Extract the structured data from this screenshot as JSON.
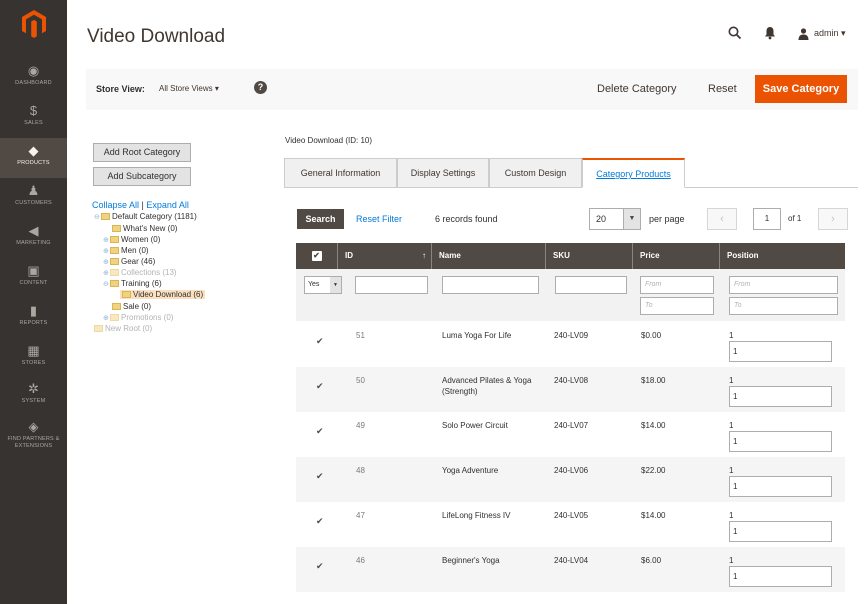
{
  "nav": {
    "items": [
      {
        "label": "Dashboard",
        "icon": "speedometer-icon",
        "glyph": "◉"
      },
      {
        "label": "Sales",
        "icon": "dollar-icon",
        "glyph": "$"
      },
      {
        "label": "Products",
        "icon": "cube-icon",
        "glyph": "◆"
      },
      {
        "label": "Customers",
        "icon": "person-icon",
        "glyph": "♟"
      },
      {
        "label": "Marketing",
        "icon": "megaphone-icon",
        "glyph": "◀"
      },
      {
        "label": "Content",
        "icon": "layout-icon",
        "glyph": "▣"
      },
      {
        "label": "Reports",
        "icon": "bar-chart-icon",
        "glyph": "▮"
      },
      {
        "label": "Stores",
        "icon": "store-icon",
        "glyph": "▦"
      },
      {
        "label": "System",
        "icon": "gear-icon",
        "glyph": "✲"
      },
      {
        "label": "Find Partners & Extensions",
        "icon": "cube-stack-icon",
        "glyph": "◈"
      }
    ]
  },
  "header": {
    "title": "Video Download",
    "user": "admin ▾"
  },
  "actions": {
    "store_view_label": "Store View:",
    "store_view_value": "All Store Views ▾",
    "help_glyph": "?",
    "delete": "Delete Category",
    "reset": "Reset",
    "save": "Save Category"
  },
  "tree": {
    "add_root": "Add Root Category",
    "add_sub": "Add Subcategory",
    "collapse_all": "Collapse All",
    "separator": " | ",
    "expand_all": "Expand All",
    "nodes": [
      {
        "label": "Default Category (1181)"
      },
      {
        "label": "What's New (0)"
      },
      {
        "label": "Women (0)"
      },
      {
        "label": "Men (0)"
      },
      {
        "label": "Gear (46)"
      },
      {
        "label": "Collections (13)"
      },
      {
        "label": "Training (6)"
      },
      {
        "label": "Video Download (6)"
      },
      {
        "label": "Sale (0)"
      },
      {
        "label": "Promotions (0)"
      },
      {
        "label": "New Root (0)"
      }
    ]
  },
  "main": {
    "breadcrumb": "Video Download (ID: 10)",
    "tabs": [
      "General Information",
      "Display Settings",
      "Custom Design",
      "Category Products"
    ],
    "search": "Search",
    "reset_filter": "Reset Filter",
    "records": "6 records found",
    "per_page_value": "20",
    "per_page_label": "per page",
    "page_current": "1",
    "page_of": "of 1",
    "prev": "‹",
    "next": "›"
  },
  "grid": {
    "columns": [
      "",
      "ID",
      "Name",
      "SKU",
      "Price",
      "Position"
    ],
    "filter": {
      "in_category": "Yes",
      "from": "From",
      "to": "To"
    },
    "rows": [
      {
        "id": "51",
        "name": "Luma Yoga For Life",
        "sku": "240-LV09",
        "price": "$0.00",
        "position": "1",
        "position_value": "1"
      },
      {
        "id": "50",
        "name": "Advanced Pilates & Yoga (Strength)",
        "sku": "240-LV08",
        "price": "$18.00",
        "position": "1",
        "position_value": "1"
      },
      {
        "id": "49",
        "name": "Solo Power Circuit",
        "sku": "240-LV07",
        "price": "$14.00",
        "position": "1",
        "position_value": "1"
      },
      {
        "id": "48",
        "name": "Yoga Adventure",
        "sku": "240-LV06",
        "price": "$22.00",
        "position": "1",
        "position_value": "1"
      },
      {
        "id": "47",
        "name": "LifeLong Fitness IV",
        "sku": "240-LV05",
        "price": "$14.00",
        "position": "1",
        "position_value": "1"
      },
      {
        "id": "46",
        "name": "Beginner's Yoga",
        "sku": "240-LV04",
        "price": "$6.00",
        "position": "1",
        "position_value": "1"
      }
    ]
  },
  "colors": {
    "nav_bg": "#373330",
    "accent": "#eb5202",
    "link": "#007bdb",
    "grid_header": "#514943"
  }
}
